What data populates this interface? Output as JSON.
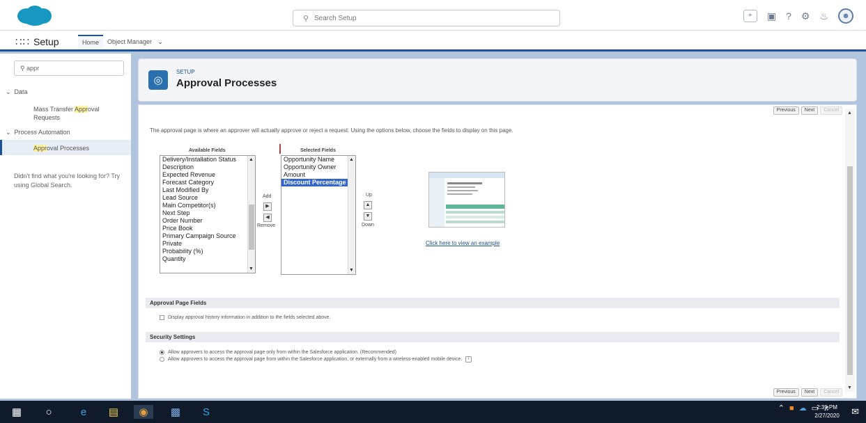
{
  "header": {
    "search_placeholder": "Search Setup",
    "icons": [
      "add-icon",
      "grid-icon",
      "help-icon",
      "gear-icon",
      "bell-icon",
      "avatar"
    ]
  },
  "context": {
    "app_name": "Setup",
    "tabs": [
      {
        "label": "Home"
      },
      {
        "label": "Object Manager"
      }
    ]
  },
  "sidebar": {
    "quickfind_value": "appr",
    "data_label": "Data",
    "data_child_prefix": "Mass Transfer ",
    "data_child_highlight": "Appr",
    "data_child_suffix": "oval Requests",
    "process_label": "Process Automation",
    "process_child_highlight": "Appr",
    "process_child_suffix": "oval Processes",
    "help_text": "Didn't find what you're looking for? Try using Global Search."
  },
  "page_header": {
    "eyebrow": "SETUP",
    "title": "Approval Processes"
  },
  "main": {
    "intro": "The approval page is where an approver will actually approve or reject a request. Using the options below, choose the fields to display on this page.",
    "top_buttons": [
      "Previous",
      "Next",
      "Cancel"
    ],
    "bottom_buttons": [
      "Previous",
      "Next",
      "Cancel"
    ],
    "available_title": "Available Fields",
    "selected_title": "Selected Fields",
    "available_fields": [
      "Delivery/Installation Status",
      "Description",
      "Expected Revenue",
      "Forecast Category",
      "Last Modified By",
      "Lead Source",
      "Main Competitor(s)",
      "Next Step",
      "Order Number",
      "Price Book",
      "Primary Campaign Source",
      "Private",
      "Probability (%)",
      "Quantity"
    ],
    "selected_fields": [
      "Opportunity Name",
      "Opportunity Owner",
      "Amount",
      "Discount Percentage"
    ],
    "add_label": "Add",
    "remove_label": "Remove",
    "up_label": "Up",
    "down_label": "Down",
    "example_link": "Click here to view an example",
    "approval_page_fields_title": "Approval Page Fields",
    "history_checkbox_label": "Display approval history information in addition to the fields selected above.",
    "security_title": "Security Settings",
    "security_option_1": "Allow approvers to access the approval page only from within the Salesforce application. (Recommended)",
    "security_option_2": "Allow approvers to access the approval page from within the Salesforce application, or externally from a wireless-enabled mobile device."
  },
  "taskbar": {
    "time": "2:39 PM",
    "date": "2/27/2020"
  },
  "colors": {
    "brand_blue": "#1b5297",
    "selected_option": "#3366cc",
    "salesforce_cloud": "#1798c1"
  }
}
